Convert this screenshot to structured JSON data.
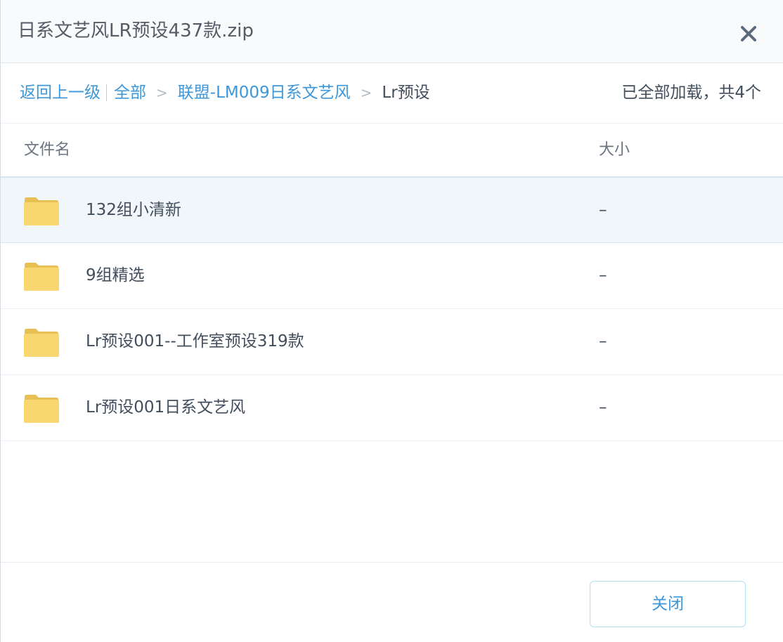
{
  "dialog": {
    "title": "日系文艺风LR预设437款.zip"
  },
  "breadcrumb": {
    "back_label": "返回上一级",
    "items": [
      {
        "label": "全部"
      },
      {
        "label": "联盟-LM009日系文艺风"
      },
      {
        "label": "Lr预设"
      }
    ],
    "separator": ">"
  },
  "status": {
    "text": "已全部加载，共4个"
  },
  "table": {
    "columns": {
      "name": "文件名",
      "size": "大小"
    },
    "rows": [
      {
        "name": "132组小清新",
        "size": "–",
        "icon": "folder-icon",
        "selected": true
      },
      {
        "name": "9组精选",
        "size": "–",
        "icon": "folder-icon",
        "selected": false
      },
      {
        "name": "Lr预设001--工作室预设319款",
        "size": "–",
        "icon": "folder-icon",
        "selected": false
      },
      {
        "name": "Lr预设001日系文艺风",
        "size": "–",
        "icon": "folder-icon",
        "selected": false
      }
    ]
  },
  "footer": {
    "close_label": "关闭"
  },
  "colors": {
    "link": "#3d97d9",
    "text": "#424e5c",
    "folder": "#f8d670",
    "selected_row": "#f0f6fa"
  }
}
